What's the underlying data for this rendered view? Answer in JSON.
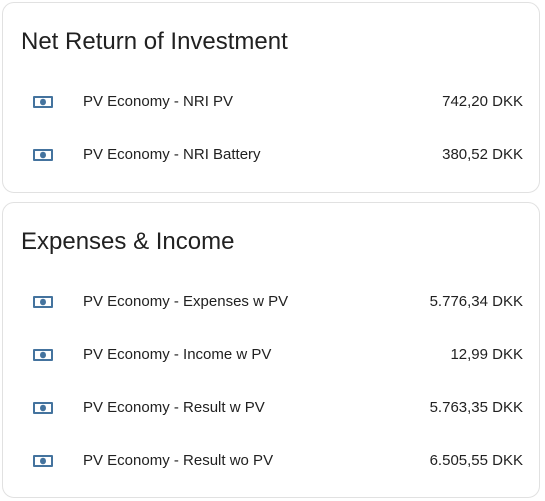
{
  "colors": {
    "icon": "#44739e",
    "text": "#212121",
    "border": "#e1e1e1"
  },
  "cards": [
    {
      "title": "Net Return of Investment",
      "rows": [
        {
          "icon": "cash-icon",
          "label": "PV Economy - NRI PV",
          "value": "742,20 DKK"
        },
        {
          "icon": "cash-icon",
          "label": "PV Economy - NRI Battery",
          "value": "380,52 DKK"
        }
      ]
    },
    {
      "title": "Expenses & Income",
      "rows": [
        {
          "icon": "cash-icon",
          "label": "PV Economy - Expenses w PV",
          "value": "5.776,34 DKK"
        },
        {
          "icon": "cash-icon",
          "label": "PV Economy - Income w PV",
          "value": "12,99 DKK"
        },
        {
          "icon": "cash-icon",
          "label": "PV Economy - Result w PV",
          "value": "5.763,35 DKK"
        },
        {
          "icon": "cash-icon",
          "label": "PV Economy - Result wo PV",
          "value": "6.505,55 DKK"
        }
      ]
    }
  ]
}
